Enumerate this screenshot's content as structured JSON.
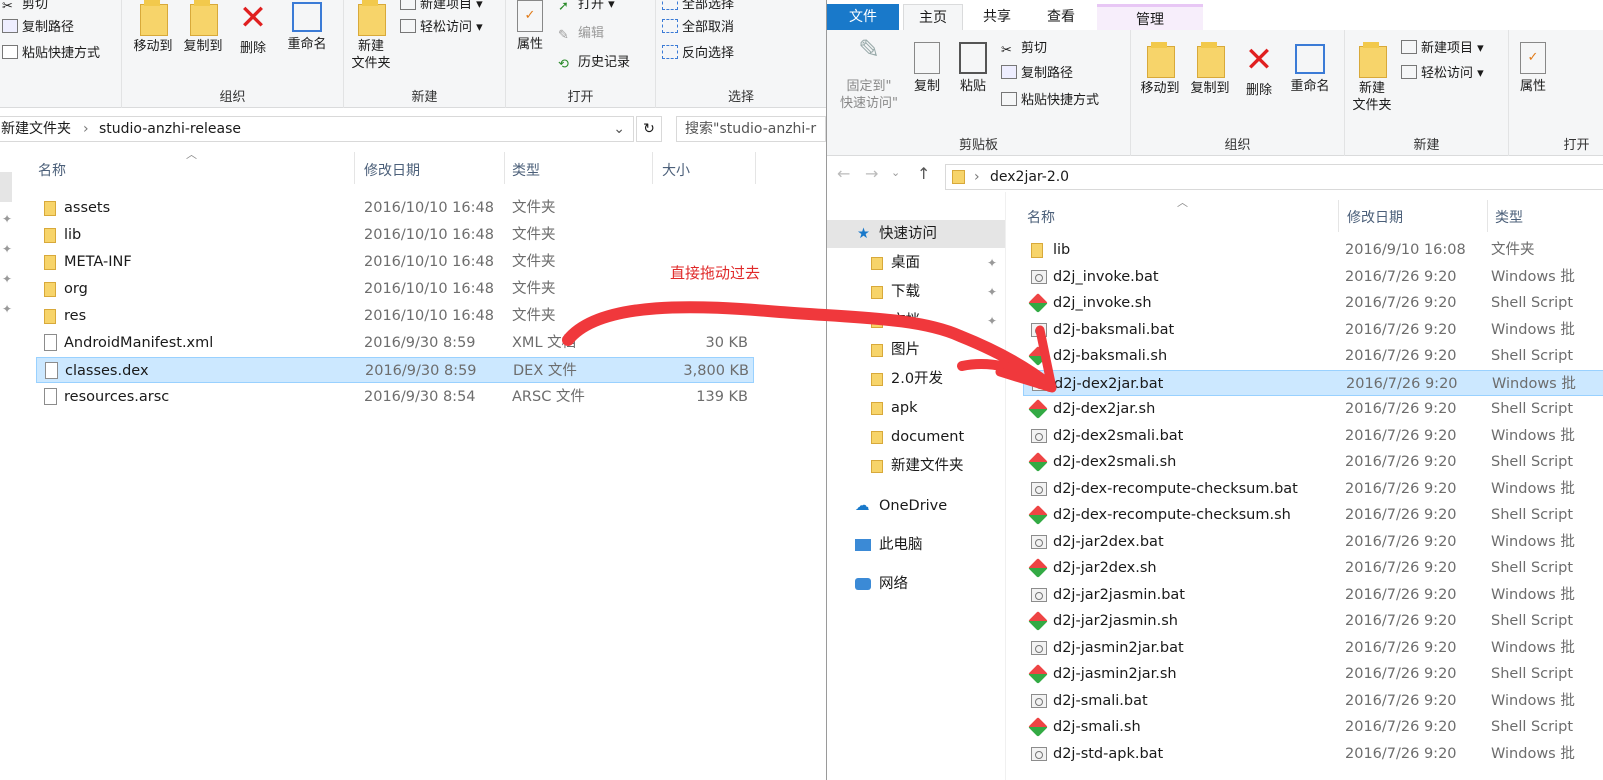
{
  "left": {
    "ribbon": {
      "clipboard_small": [
        "剪切",
        "复制路径",
        "粘贴快捷方式"
      ],
      "organize": {
        "move_to": "移动到",
        "copy_to": "复制到",
        "delete": "删除",
        "rename": "重命名",
        "label": "组织"
      },
      "new": {
        "new_folder_l1": "新建",
        "new_folder_l2": "文件夹",
        "new_item": "新建项目",
        "easy_access": "轻松访问",
        "label": "新建"
      },
      "open": {
        "properties": "属性",
        "open": "打开",
        "edit": "编辑",
        "history": "历史记录",
        "label": "打开"
      },
      "select": {
        "select_all": "全部选择",
        "select_none": "全部取消",
        "invert": "反向选择",
        "label": "选择"
      }
    },
    "breadcrumb": {
      "parent": "新建文件夹",
      "current": "studio-anzhi-release"
    },
    "search_placeholder": "搜索\"studio-anzhi-r",
    "columns": {
      "name": "名称",
      "date": "修改日期",
      "type": "类型",
      "size": "大小"
    },
    "files": [
      {
        "name": "assets",
        "date": "2016/10/10 16:48",
        "type": "文件夹",
        "size": "",
        "icon": "folder"
      },
      {
        "name": "lib",
        "date": "2016/10/10 16:48",
        "type": "文件夹",
        "size": "",
        "icon": "folder"
      },
      {
        "name": "META-INF",
        "date": "2016/10/10 16:48",
        "type": "文件夹",
        "size": "",
        "icon": "folder"
      },
      {
        "name": "org",
        "date": "2016/10/10 16:48",
        "type": "文件夹",
        "size": "",
        "icon": "folder"
      },
      {
        "name": "res",
        "date": "2016/10/10 16:48",
        "type": "文件夹",
        "size": "",
        "icon": "folder"
      },
      {
        "name": "AndroidManifest.xml",
        "date": "2016/9/30 8:59",
        "type": "XML 文档",
        "size": "30 KB",
        "icon": "doc"
      },
      {
        "name": "classes.dex",
        "date": "2016/9/30 8:59",
        "type": "DEX 文件",
        "size": "3,800 KB",
        "icon": "doc",
        "selected": true
      },
      {
        "name": "resources.arsc",
        "date": "2016/9/30 8:54",
        "type": "ARSC 文件",
        "size": "139 KB",
        "icon": "doc"
      }
    ]
  },
  "annotation": "直接拖动过去",
  "right": {
    "tabs": [
      "文件",
      "主页",
      "共享",
      "查看",
      "管理"
    ],
    "ribbon": {
      "clipboard": {
        "pin_l1": "固定到\"",
        "pin_l2": "快速访问\"",
        "copy": "复制",
        "paste": "粘贴",
        "cut": "剪切",
        "copy_path": "复制路径",
        "paste_shortcut": "粘贴快捷方式",
        "label": "剪贴板"
      },
      "organize": {
        "move_to": "移动到",
        "copy_to": "复制到",
        "delete": "删除",
        "rename": "重命名",
        "label": "组织"
      },
      "new": {
        "new_folder_l1": "新建",
        "new_folder_l2": "文件夹",
        "new_item": "新建项目",
        "easy_access": "轻松访问",
        "label": "新建"
      },
      "open": {
        "properties": "属性",
        "label": "打开"
      }
    },
    "breadcrumb": {
      "current": "dex2jar-2.0"
    },
    "nav": {
      "quick_access": "快速访问",
      "items": [
        "桌面",
        "下载",
        "文档",
        "图片",
        "2.0开发",
        "apk",
        "document",
        "新建文件夹"
      ],
      "onedrive": "OneDrive",
      "this_pc": "此电脑",
      "network": "网络"
    },
    "columns": {
      "name": "名称",
      "date": "修改日期",
      "type": "类型"
    },
    "files": [
      {
        "name": "lib",
        "date": "2016/9/10 16:08",
        "type": "文件夹",
        "icon": "folder"
      },
      {
        "name": "d2j_invoke.bat",
        "date": "2016/7/26 9:20",
        "type": "Windows 批",
        "icon": "bat"
      },
      {
        "name": "d2j_invoke.sh",
        "date": "2016/7/26 9:20",
        "type": "Shell Script",
        "icon": "sh"
      },
      {
        "name": "d2j-baksmali.bat",
        "date": "2016/7/26 9:20",
        "type": "Windows 批",
        "icon": "bat"
      },
      {
        "name": "d2j-baksmali.sh",
        "date": "2016/7/26 9:20",
        "type": "Shell Script",
        "icon": "sh"
      },
      {
        "name": "d2j-dex2jar.bat",
        "date": "2016/7/26 9:20",
        "type": "Windows 批",
        "icon": "bat",
        "selected": true
      },
      {
        "name": "d2j-dex2jar.sh",
        "date": "2016/7/26 9:20",
        "type": "Shell Script",
        "icon": "sh"
      },
      {
        "name": "d2j-dex2smali.bat",
        "date": "2016/7/26 9:20",
        "type": "Windows 批",
        "icon": "bat"
      },
      {
        "name": "d2j-dex2smali.sh",
        "date": "2016/7/26 9:20",
        "type": "Shell Script",
        "icon": "sh"
      },
      {
        "name": "d2j-dex-recompute-checksum.bat",
        "date": "2016/7/26 9:20",
        "type": "Windows 批",
        "icon": "bat"
      },
      {
        "name": "d2j-dex-recompute-checksum.sh",
        "date": "2016/7/26 9:20",
        "type": "Shell Script",
        "icon": "sh"
      },
      {
        "name": "d2j-jar2dex.bat",
        "date": "2016/7/26 9:20",
        "type": "Windows 批",
        "icon": "bat"
      },
      {
        "name": "d2j-jar2dex.sh",
        "date": "2016/7/26 9:20",
        "type": "Shell Script",
        "icon": "sh"
      },
      {
        "name": "d2j-jar2jasmin.bat",
        "date": "2016/7/26 9:20",
        "type": "Windows 批",
        "icon": "bat"
      },
      {
        "name": "d2j-jar2jasmin.sh",
        "date": "2016/7/26 9:20",
        "type": "Shell Script",
        "icon": "sh"
      },
      {
        "name": "d2j-jasmin2jar.bat",
        "date": "2016/7/26 9:20",
        "type": "Windows 批",
        "icon": "bat"
      },
      {
        "name": "d2j-jasmin2jar.sh",
        "date": "2016/7/26 9:20",
        "type": "Shell Script",
        "icon": "sh"
      },
      {
        "name": "d2j-smali.bat",
        "date": "2016/7/26 9:20",
        "type": "Windows 批",
        "icon": "bat"
      },
      {
        "name": "d2j-smali.sh",
        "date": "2016/7/26 9:20",
        "type": "Shell Script",
        "icon": "sh"
      },
      {
        "name": "d2j-std-apk.bat",
        "date": "2016/7/26 9:20",
        "type": "Windows 批",
        "icon": "bat"
      }
    ]
  },
  "colors": {
    "accent": "#1979ca",
    "selection": "#cce8ff",
    "annotation": "#e02a2a"
  }
}
